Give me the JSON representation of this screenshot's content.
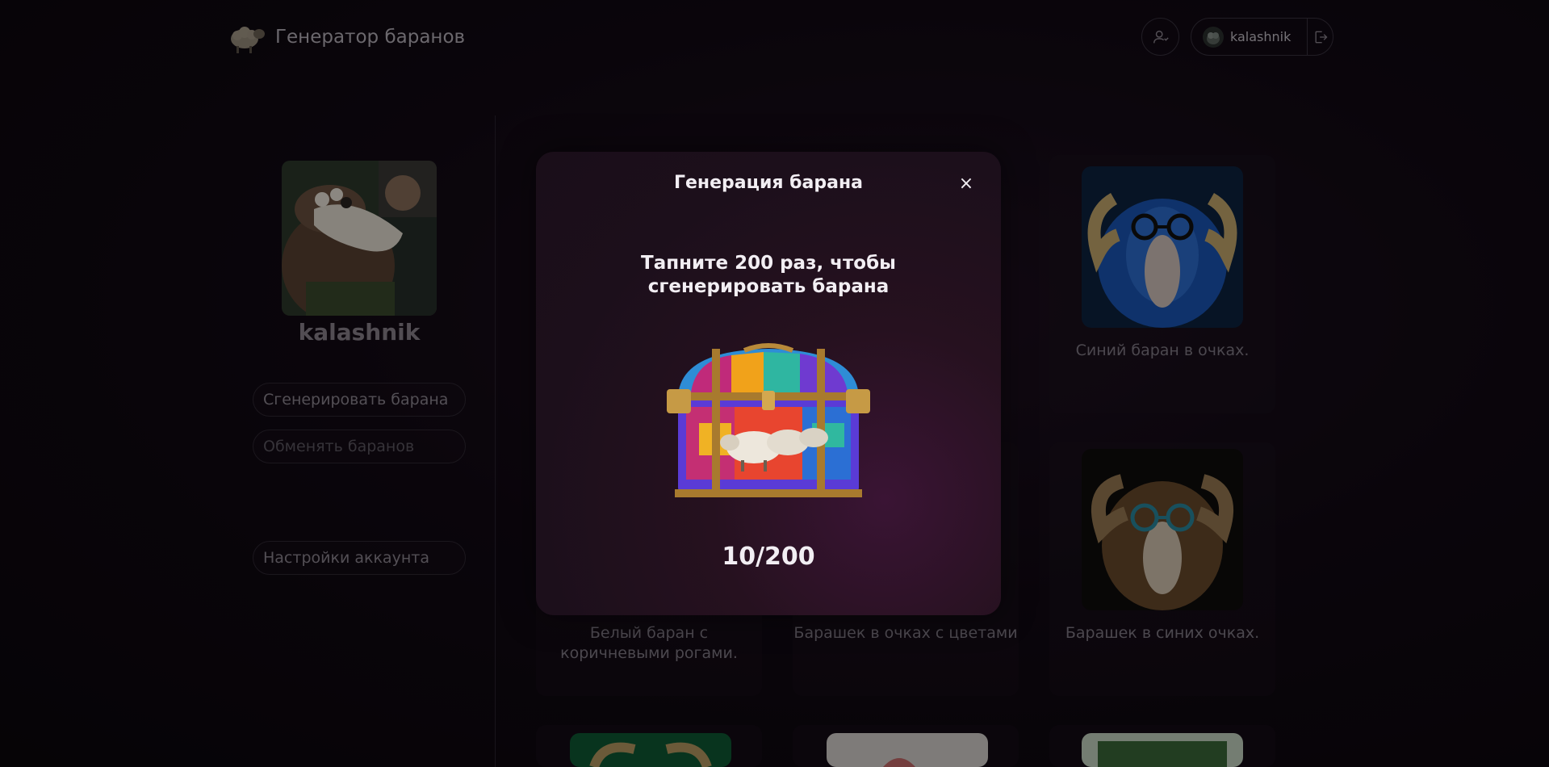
{
  "header": {
    "app_title": "Генератор баранов",
    "username": "kalashnik"
  },
  "sidebar": {
    "profile_name": "kalashnik",
    "buttons": {
      "generate": "Сгенерировать барана",
      "exchange": "Обменять баранов",
      "settings": "Настройки аккаунта"
    }
  },
  "cards": [
    {
      "caption": "Синий баран в очках."
    },
    {
      "caption": "Белый баран с коричневыми рогами."
    },
    {
      "caption": "Барашек в очках с цветами"
    },
    {
      "caption": "Барашек в синих очках."
    }
  ],
  "modal": {
    "title": "Генерация барана",
    "close_label": "×",
    "instruction": "Тапните 200 раз, чтобы сгенерировать барана",
    "counter": "10/200"
  },
  "colors": {
    "background": "#0c070d",
    "modal_bg": "#1c0f1b",
    "text_primary": "#f2eef3",
    "text_muted": "#847d88"
  }
}
